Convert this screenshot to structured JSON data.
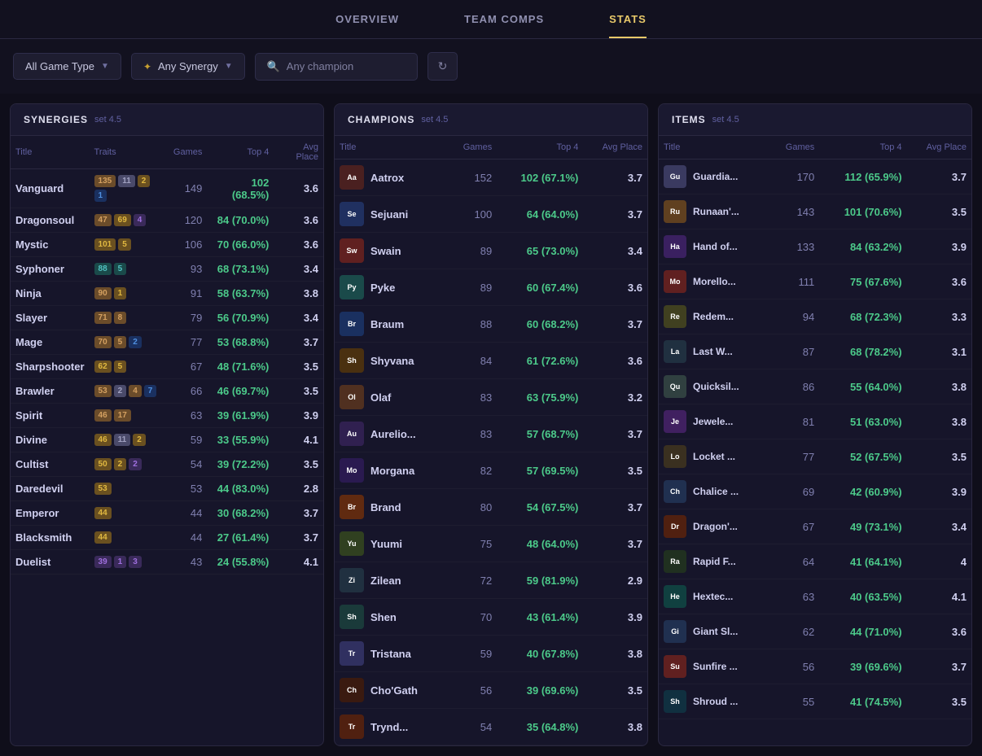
{
  "nav": {
    "tabs": [
      {
        "id": "overview",
        "label": "OVERVIEW",
        "active": false
      },
      {
        "id": "team-comps",
        "label": "TEAM COMPS",
        "active": false
      },
      {
        "id": "stats",
        "label": "STATS",
        "active": true
      }
    ]
  },
  "filters": {
    "game_type": {
      "label": "All Game Type",
      "placeholder": "Game Type"
    },
    "synergy": {
      "label": "Any Synergy",
      "placeholder": "Any Synergy"
    },
    "champion": {
      "label": "Any champion",
      "placeholder": "Any champion"
    },
    "refresh_icon": "↻"
  },
  "synergies": {
    "title": "SYNERGIES",
    "set": "set 4.5",
    "columns": [
      "Title",
      "Traits",
      "Games",
      "Top 4",
      "Avg Place"
    ],
    "rows": [
      {
        "title": "Vanguard",
        "games": 149,
        "top4": "102 (68.5%)",
        "avg": "3.6",
        "badges": [
          {
            "num": 135,
            "type": "bronze"
          },
          {
            "num": 11,
            "type": "silver"
          },
          {
            "num": 2,
            "type": "gold"
          },
          {
            "num": 1,
            "type": "blue"
          }
        ]
      },
      {
        "title": "Dragonsoul",
        "games": 120,
        "top4": "84 (70.0%)",
        "avg": "3.6",
        "badges": [
          {
            "num": 47,
            "type": "bronze"
          },
          {
            "num": 69,
            "type": "gold"
          },
          {
            "num": 4,
            "type": "purple"
          }
        ]
      },
      {
        "title": "Mystic",
        "games": 106,
        "top4": "70 (66.0%)",
        "avg": "3.6",
        "badges": [
          {
            "num": 101,
            "type": "gold"
          },
          {
            "num": 5,
            "type": "gold"
          }
        ]
      },
      {
        "title": "Syphoner",
        "games": 93,
        "top4": "68 (73.1%)",
        "avg": "3.4",
        "badges": [
          {
            "num": 88,
            "type": "teal"
          },
          {
            "num": 5,
            "type": "teal"
          }
        ]
      },
      {
        "title": "Ninja",
        "games": 91,
        "top4": "58 (63.7%)",
        "avg": "3.8",
        "badges": [
          {
            "num": 90,
            "type": "bronze"
          },
          {
            "num": 1,
            "type": "gold"
          }
        ]
      },
      {
        "title": "Slayer",
        "games": 79,
        "top4": "56 (70.9%)",
        "avg": "3.4",
        "badges": [
          {
            "num": 71,
            "type": "bronze"
          },
          {
            "num": 8,
            "type": "bronze"
          }
        ]
      },
      {
        "title": "Mage",
        "games": 77,
        "top4": "53 (68.8%)",
        "avg": "3.7",
        "badges": [
          {
            "num": 70,
            "type": "bronze"
          },
          {
            "num": 5,
            "type": "bronze"
          },
          {
            "num": 2,
            "type": "blue"
          }
        ]
      },
      {
        "title": "Sharpshooter",
        "games": 67,
        "top4": "48 (71.6%)",
        "avg": "3.5",
        "badges": [
          {
            "num": 62,
            "type": "gold"
          },
          {
            "num": 5,
            "type": "gold"
          }
        ]
      },
      {
        "title": "Brawler",
        "games": 66,
        "top4": "46 (69.7%)",
        "avg": "3.5",
        "badges": [
          {
            "num": 53,
            "type": "bronze"
          },
          {
            "num": 2,
            "type": "silver"
          },
          {
            "num": 4,
            "type": "bronze"
          },
          {
            "num": 7,
            "type": "blue"
          }
        ]
      },
      {
        "title": "Spirit",
        "games": 63,
        "top4": "39 (61.9%)",
        "avg": "3.9",
        "badges": [
          {
            "num": 46,
            "type": "bronze"
          },
          {
            "num": 17,
            "type": "bronze"
          }
        ]
      },
      {
        "title": "Divine",
        "games": 59,
        "top4": "33 (55.9%)",
        "avg": "4.1",
        "badges": [
          {
            "num": 46,
            "type": "gold"
          },
          {
            "num": 11,
            "type": "silver"
          },
          {
            "num": 2,
            "type": "gold"
          }
        ]
      },
      {
        "title": "Cultist",
        "games": 54,
        "top4": "39 (72.2%)",
        "avg": "3.5",
        "badges": [
          {
            "num": 50,
            "type": "gold"
          },
          {
            "num": 2,
            "type": "gold"
          },
          {
            "num": 2,
            "type": "purple"
          }
        ]
      },
      {
        "title": "Daredevil",
        "games": 53,
        "top4": "44 (83.0%)",
        "avg": "2.8",
        "badges": [
          {
            "num": 53,
            "type": "gold"
          }
        ]
      },
      {
        "title": "Emperor",
        "games": 44,
        "top4": "30 (68.2%)",
        "avg": "3.7",
        "badges": [
          {
            "num": 44,
            "type": "gold"
          }
        ]
      },
      {
        "title": "Blacksmith",
        "games": 44,
        "top4": "27 (61.4%)",
        "avg": "3.7",
        "badges": [
          {
            "num": 44,
            "type": "gold"
          }
        ]
      },
      {
        "title": "Duelist",
        "games": 43,
        "top4": "24 (55.8%)",
        "avg": "4.1",
        "badges": [
          {
            "num": 39,
            "type": "purple"
          },
          {
            "num": 1,
            "type": "purple"
          },
          {
            "num": 3,
            "type": "purple"
          }
        ]
      }
    ]
  },
  "champions": {
    "title": "CHAMPIONS",
    "set": "set 4.5",
    "columns": [
      "Title",
      "Games",
      "Top 4",
      "Avg Place"
    ],
    "rows": [
      {
        "title": "Aatrox",
        "games": 152,
        "top4": "102 (67.1%)",
        "avg": "3.7",
        "color": "#4a2020"
      },
      {
        "title": "Sejuani",
        "games": 100,
        "top4": "64 (64.0%)",
        "avg": "3.7",
        "color": "#203060"
      },
      {
        "title": "Swain",
        "games": 89,
        "top4": "65 (73.0%)",
        "avg": "3.4",
        "color": "#602020"
      },
      {
        "title": "Pyke",
        "games": 89,
        "top4": "60 (67.4%)",
        "avg": "3.6",
        "color": "#1a4a4a"
      },
      {
        "title": "Braum",
        "games": 88,
        "top4": "60 (68.2%)",
        "avg": "3.7",
        "color": "#1a3060"
      },
      {
        "title": "Shyvana",
        "games": 84,
        "top4": "61 (72.6%)",
        "avg": "3.6",
        "color": "#4a3010"
      },
      {
        "title": "Olaf",
        "games": 83,
        "top4": "63 (75.9%)",
        "avg": "3.2",
        "color": "#503020"
      },
      {
        "title": "Aurelio...",
        "games": 83,
        "top4": "57 (68.7%)",
        "avg": "3.7",
        "color": "#302050"
      },
      {
        "title": "Morgana",
        "games": 82,
        "top4": "57 (69.5%)",
        "avg": "3.5",
        "color": "#2a1a50"
      },
      {
        "title": "Brand",
        "games": 80,
        "top4": "54 (67.5%)",
        "avg": "3.7",
        "color": "#602a10"
      },
      {
        "title": "Yuumi",
        "games": 75,
        "top4": "48 (64.0%)",
        "avg": "3.7",
        "color": "#304020"
      },
      {
        "title": "Zilean",
        "games": 72,
        "top4": "59 (81.9%)",
        "avg": "2.9",
        "color": "#203040"
      },
      {
        "title": "Shen",
        "games": 70,
        "top4": "43 (61.4%)",
        "avg": "3.9",
        "color": "#1a3a3a"
      },
      {
        "title": "Tristana",
        "games": 59,
        "top4": "40 (67.8%)",
        "avg": "3.8",
        "color": "#303060"
      },
      {
        "title": "Cho'Gath",
        "games": 56,
        "top4": "39 (69.6%)",
        "avg": "3.5",
        "color": "#3a1a10"
      },
      {
        "title": "Trynd...",
        "games": 54,
        "top4": "35 (64.8%)",
        "avg": "3.8",
        "color": "#502010"
      }
    ]
  },
  "items": {
    "title": "ITEMS",
    "set": "set 4.5",
    "columns": [
      "Title",
      "Games",
      "Top 4",
      "Avg Place"
    ],
    "rows": [
      {
        "title": "Guardia...",
        "games": 170,
        "top4": "112 (65.9%)",
        "avg": "3.7",
        "color": "#3a3a60"
      },
      {
        "title": "Runaan'...",
        "games": 143,
        "top4": "101 (70.6%)",
        "avg": "3.5",
        "color": "#604020"
      },
      {
        "title": "Hand of...",
        "games": 133,
        "top4": "84 (63.2%)",
        "avg": "3.9",
        "color": "#3a2060"
      },
      {
        "title": "Morello...",
        "games": 111,
        "top4": "75 (67.6%)",
        "avg": "3.6",
        "color": "#602020"
      },
      {
        "title": "Redem...",
        "games": 94,
        "top4": "68 (72.3%)",
        "avg": "3.3",
        "color": "#404020"
      },
      {
        "title": "Last W...",
        "games": 87,
        "top4": "68 (78.2%)",
        "avg": "3.1",
        "color": "#203040"
      },
      {
        "title": "Quicksil...",
        "games": 86,
        "top4": "55 (64.0%)",
        "avg": "3.8",
        "color": "#304040"
      },
      {
        "title": "Jewele...",
        "games": 81,
        "top4": "51 (63.0%)",
        "avg": "3.8",
        "color": "#402060"
      },
      {
        "title": "Locket ...",
        "games": 77,
        "top4": "52 (67.5%)",
        "avg": "3.5",
        "color": "#3a3020"
      },
      {
        "title": "Chalice ...",
        "games": 69,
        "top4": "42 (60.9%)",
        "avg": "3.9",
        "color": "#203050"
      },
      {
        "title": "Dragon'...",
        "games": 67,
        "top4": "49 (73.1%)",
        "avg": "3.4",
        "color": "#502010"
      },
      {
        "title": "Rapid F...",
        "games": 64,
        "top4": "41 (64.1%)",
        "avg": "4",
        "color": "#203020"
      },
      {
        "title": "Hextec...",
        "games": 63,
        "top4": "40 (63.5%)",
        "avg": "4.1",
        "color": "#104040"
      },
      {
        "title": "Giant Sl...",
        "games": 62,
        "top4": "44 (71.0%)",
        "avg": "3.6",
        "color": "#203050"
      },
      {
        "title": "Sunfire ...",
        "games": 56,
        "top4": "39 (69.6%)",
        "avg": "3.7",
        "color": "#602020"
      },
      {
        "title": "Shroud ...",
        "games": 55,
        "top4": "41 (74.5%)",
        "avg": "3.5",
        "color": "#103040"
      }
    ]
  }
}
